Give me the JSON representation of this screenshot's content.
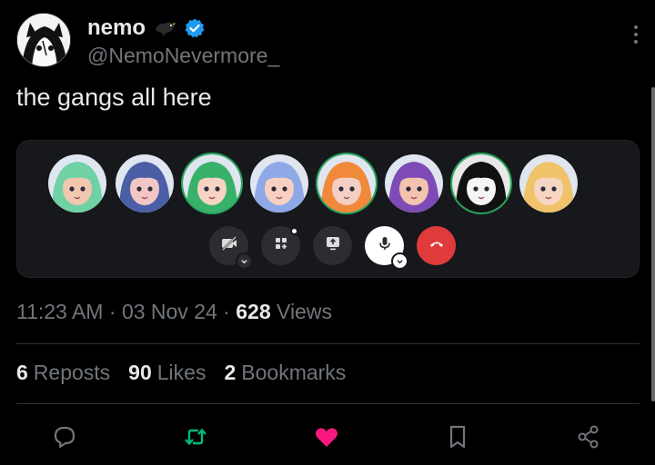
{
  "author": {
    "display_name": "nemo",
    "handle": "@NemoNevermore_"
  },
  "tweet": {
    "text": "the gangs all here"
  },
  "call": {
    "participants": [
      {
        "hair": "#6fd1a4",
        "skin": "#f1c7b0",
        "speaking": false
      },
      {
        "hair": "#4b5fa6",
        "skin": "#f3c6c6",
        "speaking": false
      },
      {
        "hair": "#38b26a",
        "skin": "#f6d3c2",
        "speaking": true
      },
      {
        "hair": "#8fa8e6",
        "skin": "#f7d0c0",
        "speaking": false
      },
      {
        "hair": "#f08a3a",
        "skin": "#f3cfc4",
        "speaking": true
      },
      {
        "hair": "#7e4bb6",
        "skin": "#f3c3b0",
        "speaking": false
      },
      {
        "hair": "#ffffff",
        "skin": "#f5f5f5",
        "speaking": true
      },
      {
        "hair": "#f0c36a",
        "skin": "#f6d6c2",
        "speaking": false
      }
    ],
    "controls": [
      "camera-off-icon",
      "activities-icon",
      "screen-share-icon",
      "microphone-icon",
      "hang-up-icon"
    ]
  },
  "meta": {
    "time": "11:23 AM",
    "sep1": " · ",
    "date": "03 Nov 24",
    "sep2": " · ",
    "views_count": "628",
    "views_label": " Views"
  },
  "stats": {
    "reposts_count": "6",
    "reposts_label": "Reposts",
    "likes_count": "90",
    "likes_label": "Likes",
    "bookmarks_count": "2",
    "bookmarks_label": "Bookmarks"
  },
  "colors": {
    "reply": "#71767b",
    "repost": "#00ba7c",
    "like": "#f91880",
    "bookmark": "#71767b",
    "share": "#71767b",
    "verified": "#1d9bf0"
  },
  "actions": [
    "reply-icon",
    "repost-icon",
    "like-icon",
    "bookmark-icon",
    "share-icon"
  ]
}
